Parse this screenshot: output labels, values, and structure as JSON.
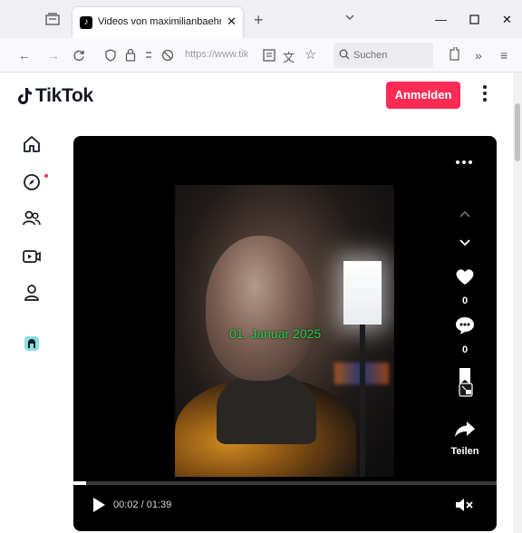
{
  "browser": {
    "tab_title": "Videos von maximilianbaehring",
    "url": "https://www.tik",
    "search_placeholder": "Suchen"
  },
  "tiktok": {
    "logo_text": "TikTok",
    "login_button": "Anmelden"
  },
  "sidebar": {
    "items": [
      "home",
      "explore",
      "following",
      "live",
      "profile",
      "app"
    ]
  },
  "video": {
    "overlay_text": "01. Januar 2025",
    "like_count": "0",
    "comment_count": "0",
    "bookmark_count": "0",
    "share_label": "Teilen",
    "time_display": "00:02 / 01:39",
    "progress": 0.03
  },
  "colors": {
    "accent": "#fe2c55",
    "overlay_text": "#21d24a"
  }
}
